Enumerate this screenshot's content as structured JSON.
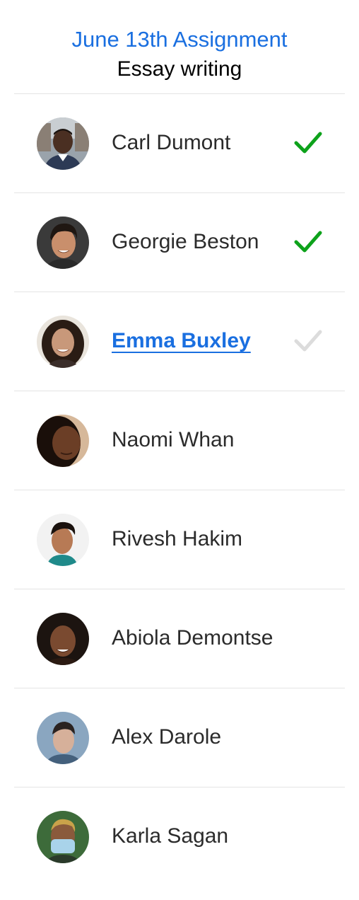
{
  "header": {
    "title": "June 13th Assignment",
    "subtitle": "Essay writing"
  },
  "students": [
    {
      "name": "Carl Dumont",
      "status": "submitted",
      "active": false,
      "avatar": "avatar-photo-1"
    },
    {
      "name": "Georgie Beston",
      "status": "submitted",
      "active": false,
      "avatar": "avatar-photo-2"
    },
    {
      "name": "Emma Buxley",
      "status": "pending",
      "active": true,
      "avatar": "avatar-photo-3"
    },
    {
      "name": "Naomi Whan",
      "status": "none",
      "active": false,
      "avatar": "avatar-photo-4"
    },
    {
      "name": "Rivesh Hakim",
      "status": "none",
      "active": false,
      "avatar": "avatar-photo-5"
    },
    {
      "name": "Abiola Demontse",
      "status": "none",
      "active": false,
      "avatar": "avatar-photo-6"
    },
    {
      "name": "Alex Darole",
      "status": "none",
      "active": false,
      "avatar": "avatar-photo-7"
    },
    {
      "name": "Karla Sagan",
      "status": "none",
      "active": false,
      "avatar": "avatar-photo-8"
    }
  ],
  "colors": {
    "accent": "#1a6fe0",
    "check_done": "#0da21b",
    "check_pending": "#dcdcdc",
    "divider": "#e4e4e4"
  },
  "icons": {
    "check": "check-icon"
  }
}
